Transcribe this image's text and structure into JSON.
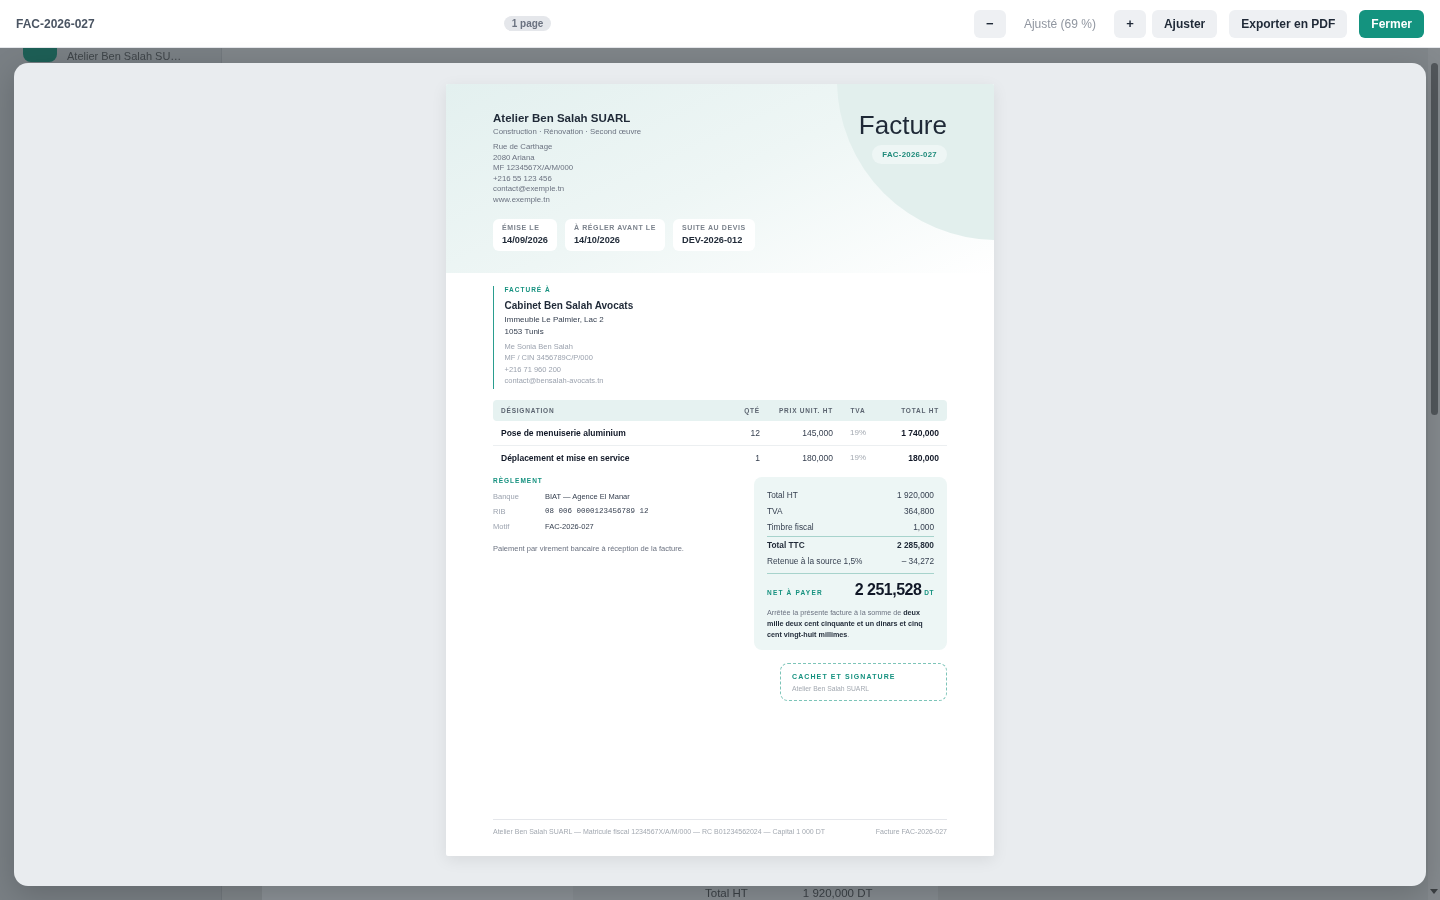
{
  "background_page": {
    "account_name": "Atelier Ben Salah SU…",
    "summary": [
      {
        "label": "Total HT",
        "value": "1 920,000 DT"
      }
    ]
  },
  "toolbar": {
    "title": "FAC-2026-027",
    "page_count": "1 page",
    "zoom_out": "−",
    "zoom_level": "Ajusté (69 %)",
    "zoom_in": "+",
    "buttons": [
      {
        "label": "Ajuster",
        "kind": "secondary"
      },
      {
        "label": "Exporter en PDF",
        "kind": "secondary"
      },
      {
        "label": "Fermer",
        "kind": "primary"
      }
    ]
  },
  "invoice": {
    "issuer": {
      "name": "Atelier Ben Salah SUARL",
      "tagline": "Construction · Rénovation · Second œuvre",
      "lines": [
        "Rue de Carthage",
        "2080 Ariana",
        "MF 1234567X/A/M/000",
        "+216 55 123 456",
        "contact@exemple.tn",
        "www.exemple.tn"
      ]
    },
    "title": "Facture",
    "number": "FAC-2026-027",
    "meta": [
      {
        "label": "ÉMISE LE",
        "value": "14/09/2026"
      },
      {
        "label": "À RÉGLER AVANT LE",
        "value": "14/10/2026"
      },
      {
        "label": "SUITE AU DEVIS",
        "value": "DEV-2026-012"
      }
    ],
    "client": {
      "heading": "FACTURÉ À",
      "name": "Cabinet Ben Salah Avocats",
      "address": [
        "Immeuble Le Palmier, Lac 2",
        "1053 Tunis"
      ],
      "details": [
        "Me Sonia Ben Salah",
        "MF / CIN 3456789C/P/000",
        "+216 71 960 200",
        "contact@bensalah-avocats.tn"
      ]
    },
    "table": {
      "columns": [
        "DÉSIGNATION",
        "QTÉ",
        "PRIX UNIT. HT",
        "TVA",
        "TOTAL HT"
      ],
      "rows": [
        [
          "Pose de menuiserie aluminium",
          "12",
          "145,000",
          "19%",
          "1 740,000"
        ],
        [
          "Déplacement et mise en service",
          "1",
          "180,000",
          "19%",
          "180,000"
        ]
      ]
    },
    "payment": {
      "heading": "RÈGLEMENT",
      "fields": [
        {
          "label": "Banque",
          "value": "BIAT — Agence El Manar",
          "kind": "text"
        },
        {
          "label": "RIB",
          "value": "08 006 0000123456789 12",
          "kind": "mono"
        },
        {
          "label": "Motif",
          "value": "FAC-2026-027",
          "kind": "text"
        }
      ],
      "note": "Paiement par virement bancaire à réception de la facture."
    },
    "totals": {
      "rows": [
        {
          "label": "Total HT",
          "value": "1 920,000",
          "kind": "normal"
        },
        {
          "label": "TVA",
          "value": "364,800",
          "kind": "normal"
        },
        {
          "label": "Timbre fiscal",
          "value": "1,000",
          "kind": "normal"
        },
        {
          "label": "Total TTC",
          "value": "2 285,800",
          "kind": "strong"
        },
        {
          "label": "Retenue à la source 1,5%",
          "value": "– 34,272",
          "kind": "normal"
        }
      ],
      "net_label": "NET À PAYER",
      "net_amount": "2 251,528",
      "currency": "DT",
      "amount_in_words": "Arrêtée la présente facture à la somme de **deux mille deux cent cinquante et un dinars et cinq cent vingt-huit millimes**."
    },
    "signature": {
      "heading": "CACHET ET SIGNATURE",
      "name": "Atelier Ben Salah SUARL"
    },
    "footer": {
      "legal": "Atelier Ben Salah SUARL — Matricule fiscal 1234567X/A/M/000 — RC B01234562024 — Capital 1 000 DT",
      "reference": "Facture FAC-2026-027"
    }
  }
}
